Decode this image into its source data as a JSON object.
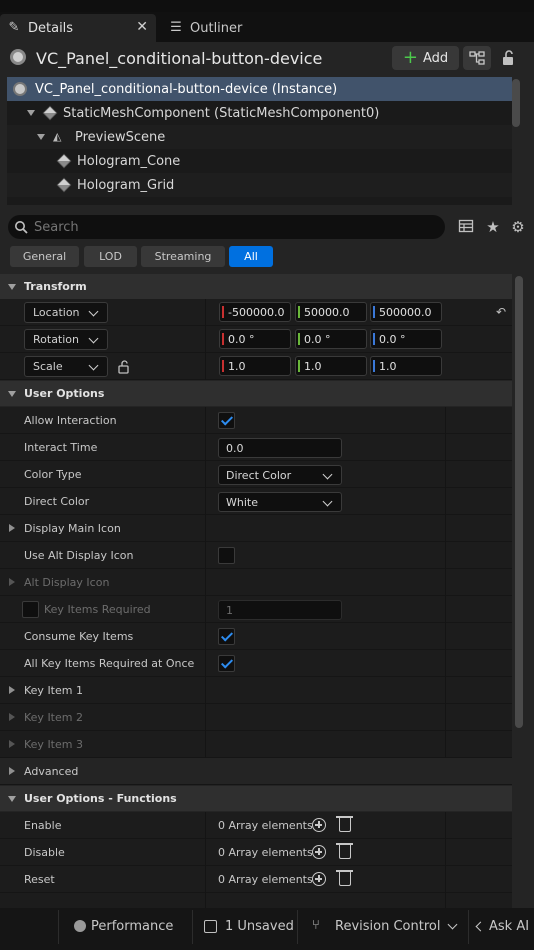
{
  "tabs": {
    "details": "Details",
    "outliner": "Outliner",
    "close": "✕"
  },
  "header": {
    "title": "VC_Panel_conditional-button-device",
    "add_label": "Add"
  },
  "tree": [
    {
      "label": "VC_Panel_conditional-button-device (Instance)"
    },
    {
      "label": "StaticMeshComponent (StaticMeshComponent0)"
    },
    {
      "label": "PreviewScene"
    },
    {
      "label": "Hologram_Cone"
    },
    {
      "label": "Hologram_Grid"
    }
  ],
  "search": {
    "placeholder": "Search"
  },
  "filters": [
    "General",
    "LOD",
    "Streaming",
    "All"
  ],
  "active_filter": "All",
  "transform": {
    "category": "Transform",
    "location": {
      "label": "Location",
      "x": "-500000.0",
      "y": "50000.0",
      "z": "500000.0"
    },
    "rotation": {
      "label": "Rotation",
      "x": "0.0 °",
      "y": "0.0 °",
      "z": "0.0 °"
    },
    "scale": {
      "label": "Scale",
      "x": "1.0",
      "y": "1.0",
      "z": "1.0"
    }
  },
  "user_options": {
    "category": "User Options",
    "allow_interaction": {
      "label": "Allow Interaction",
      "checked": true
    },
    "interact_time": {
      "label": "Interact Time",
      "value": "0.0"
    },
    "color_type": {
      "label": "Color Type",
      "value": "Direct Color"
    },
    "direct_color": {
      "label": "Direct Color",
      "value": "White"
    },
    "display_main_icon": {
      "label": "Display Main Icon"
    },
    "use_alt_display_icon": {
      "label": "Use Alt Display Icon",
      "checked": false
    },
    "alt_display_icon": {
      "label": "Alt Display Icon"
    },
    "key_items_required": {
      "label": "Key Items Required",
      "value": "1",
      "checked": false
    },
    "consume_key_items": {
      "label": "Consume Key Items",
      "checked": true
    },
    "all_key_items": {
      "label": "All Key Items Required at Once",
      "checked": true
    },
    "key_item_1": {
      "label": "Key Item 1"
    },
    "key_item_2": {
      "label": "Key Item 2"
    },
    "key_item_3": {
      "label": "Key Item 3"
    },
    "advanced": {
      "label": "Advanced"
    }
  },
  "functions": {
    "category": "User Options - Functions",
    "rows": [
      {
        "label": "Enable",
        "value": "0 Array elements"
      },
      {
        "label": "Disable",
        "value": "0 Array elements"
      },
      {
        "label": "Reset",
        "value": "0 Array elements"
      }
    ]
  },
  "status_bar": {
    "performance": "Performance",
    "unsaved": "1 Unsaved",
    "revision": "Revision Control",
    "ask_ai": "Ask AI"
  },
  "colors": {
    "selection": "#41536b",
    "active_filter": "#0070e0",
    "add_plus": "#4cc94c",
    "check": "#2d8cf0"
  }
}
